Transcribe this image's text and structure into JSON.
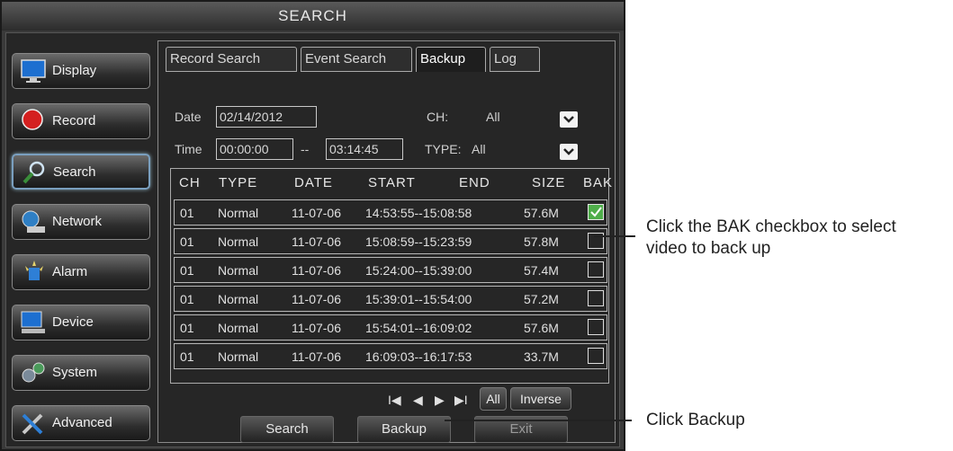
{
  "window": {
    "title": "SEARCH"
  },
  "sidebar": {
    "items": [
      {
        "label": "Display",
        "icon": "monitor-icon"
      },
      {
        "label": "Record",
        "icon": "record-icon"
      },
      {
        "label": "Search",
        "icon": "magnifier-icon"
      },
      {
        "label": "Network",
        "icon": "network-icon"
      },
      {
        "label": "Alarm",
        "icon": "alarm-icon"
      },
      {
        "label": "Device",
        "icon": "device-icon"
      },
      {
        "label": "System",
        "icon": "system-icon"
      },
      {
        "label": "Advanced",
        "icon": "tools-icon"
      }
    ],
    "active": "Search"
  },
  "tabs": [
    {
      "label": "Record Search"
    },
    {
      "label": "Event Search"
    },
    {
      "label": "Backup"
    },
    {
      "label": "Log"
    }
  ],
  "filters": {
    "date_label": "Date",
    "date_value": "02/14/2012",
    "ch_label": "CH:",
    "ch_value": "All",
    "time_label": "Time",
    "time_start": "00:00:00",
    "time_sep": "--",
    "time_end": "03:14:45",
    "type_label": "TYPE:",
    "type_value": "All"
  },
  "table": {
    "headers": [
      "CH",
      "TYPE",
      "DATE",
      "START",
      "END",
      "SIZE",
      "BAK"
    ],
    "rows": [
      {
        "ch": "01",
        "type": "Normal",
        "date": "11-07-06",
        "range": "14:53:55--15:08:58",
        "size": "57.6M",
        "bak": true
      },
      {
        "ch": "01",
        "type": "Normal",
        "date": "11-07-06",
        "range": "15:08:59--15:23:59",
        "size": "57.8M",
        "bak": false
      },
      {
        "ch": "01",
        "type": "Normal",
        "date": "11-07-06",
        "range": "15:24:00--15:39:00",
        "size": "57.4M",
        "bak": false
      },
      {
        "ch": "01",
        "type": "Normal",
        "date": "11-07-06",
        "range": "15:39:01--15:54:00",
        "size": "57.2M",
        "bak": false
      },
      {
        "ch": "01",
        "type": "Normal",
        "date": "11-07-06",
        "range": "15:54:01--16:09:02",
        "size": "57.6M",
        "bak": false
      },
      {
        "ch": "01",
        "type": "Normal",
        "date": "11-07-06",
        "range": "16:09:03--16:17:53",
        "size": "33.7M",
        "bak": false
      }
    ]
  },
  "pager": {
    "first": "I◀",
    "prev": "◀",
    "next": "▶",
    "last": "▶I",
    "all": "All",
    "inverse": "Inverse"
  },
  "actions": {
    "search": "Search",
    "backup": "Backup",
    "exit": "Exit"
  },
  "callouts": {
    "bak_line1": "Click the BAK checkbox to select",
    "bak_line2": "video to back up",
    "backup": "Click Backup"
  },
  "colors": {
    "checked": "#4fae4a",
    "highlight": "#7a9fbf"
  }
}
